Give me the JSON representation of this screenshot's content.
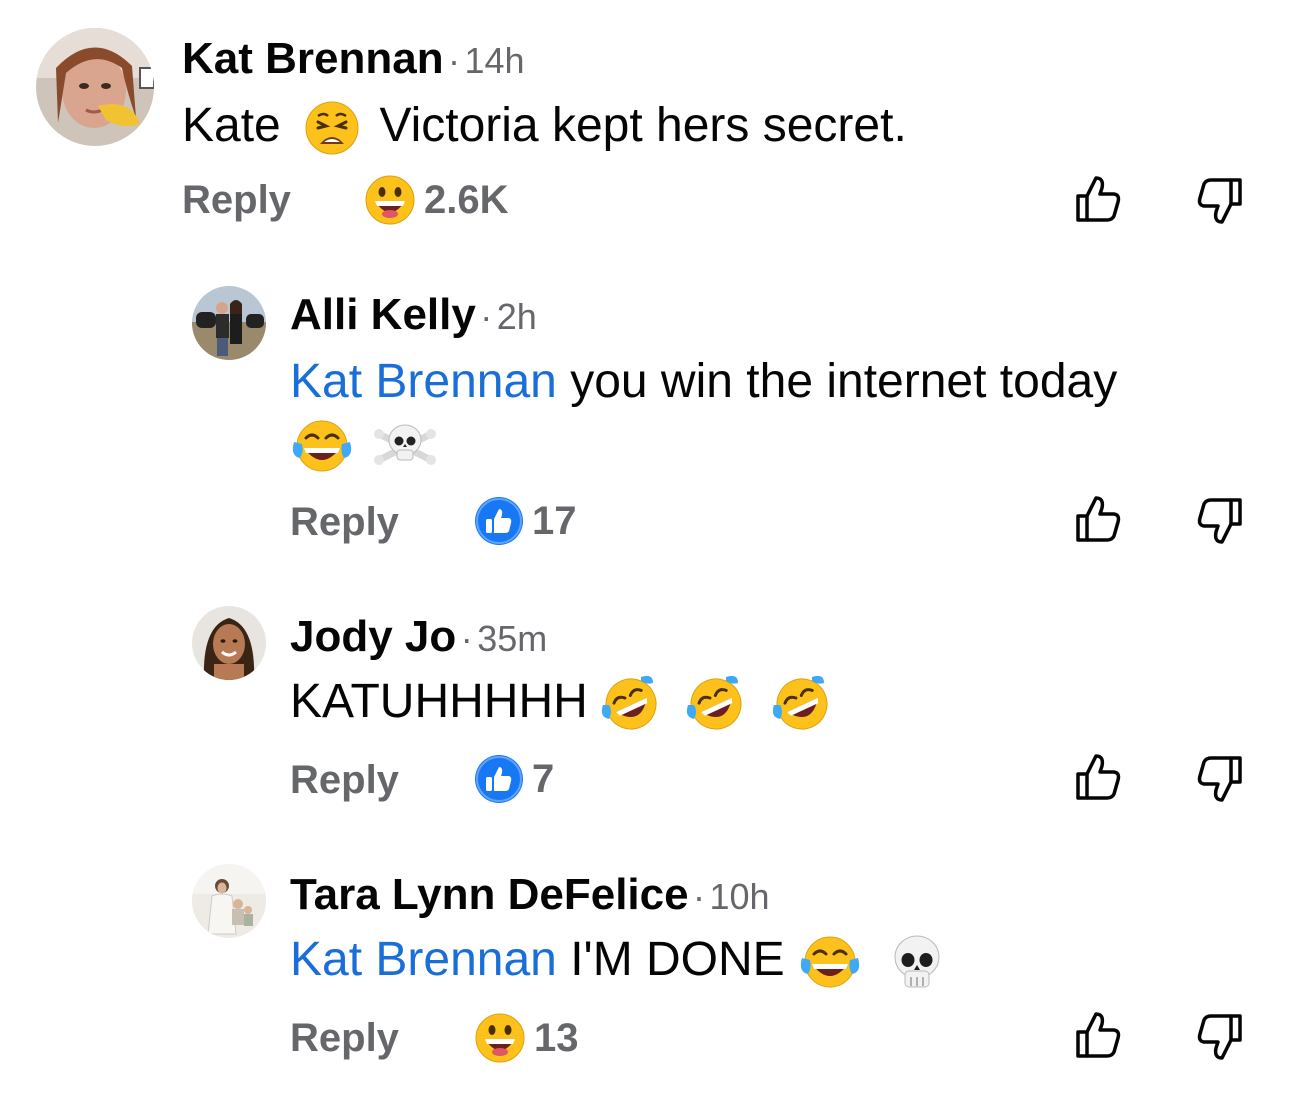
{
  "comments": [
    {
      "author": "Kat Brennan",
      "sep": "·",
      "time": "14h",
      "text_before": "Kate",
      "emoji_1": "weary-face",
      "text_after": "Victoria kept hers secret.",
      "reply_label": "Reply",
      "reaction_icon": "grinning-face",
      "reaction_count": "2.6K"
    },
    {
      "author": "Alli Kelly",
      "sep": "·",
      "time": "2h",
      "mention": "Kat Brennan",
      "text": " you win the internet today",
      "emojis_line2": [
        "face-with-tears-of-joy",
        "skull-and-crossbones"
      ],
      "reply_label": "Reply",
      "reaction_icon": "like-icon",
      "reaction_count": "17"
    },
    {
      "author": "Jody Jo",
      "sep": "·",
      "time": "35m",
      "text": "KATUHHHHH",
      "emojis": [
        "rolling-on-floor-laughing",
        "rolling-on-floor-laughing",
        "rolling-on-floor-laughing"
      ],
      "reply_label": "Reply",
      "reaction_icon": "like-icon",
      "reaction_count": "7"
    },
    {
      "author": "Tara Lynn DeFelice",
      "sep": "·",
      "time": "10h",
      "mention": "Kat Brennan",
      "text": " I'M DONE",
      "emojis": [
        "face-with-tears-of-joy",
        "skull"
      ],
      "reply_label": "Reply",
      "reaction_icon": "grinning-face",
      "reaction_count": "13"
    }
  ],
  "colors": {
    "mention": "#1a6ed8",
    "secondary": "#65676b",
    "like_blue": "#1877f2"
  }
}
